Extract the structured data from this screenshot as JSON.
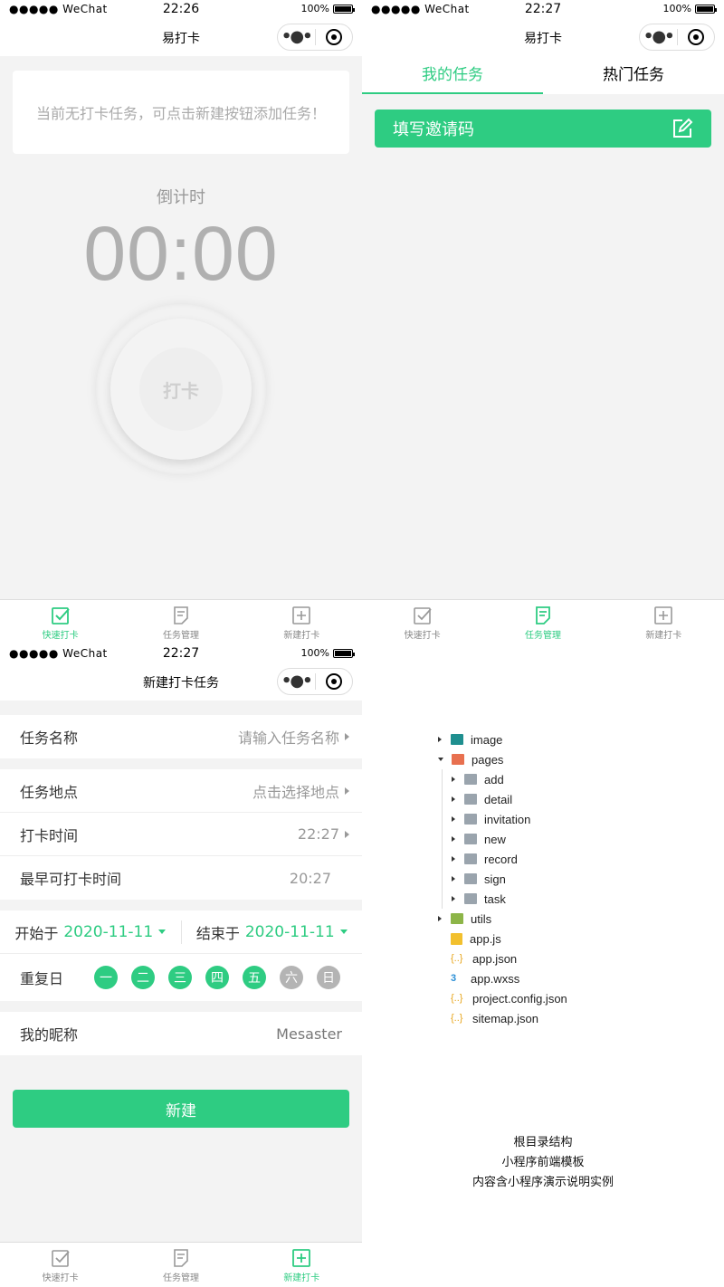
{
  "status_bars": [
    {
      "signal": "●●●●● WeChat",
      "time": "22:26",
      "battery": "100%"
    },
    {
      "signal": "●●●●● WeChat",
      "time": "22:27",
      "battery": "100%"
    },
    {
      "signal": "●●●●● WeChat",
      "time": "22:27",
      "battery": "100%"
    }
  ],
  "screen1": {
    "title": "易打卡",
    "notice": "当前无打卡任务，可点击新建按钮添加任务！",
    "countdown_label": "倒计时",
    "countdown_time": "00:00",
    "punch_label": "打卡"
  },
  "screen2": {
    "title": "易打卡",
    "tabs": [
      "我的任务",
      "热门任务"
    ],
    "invite_label": "填写邀请码"
  },
  "screen3": {
    "title": "新建打卡任务",
    "task_name_label": "任务名称",
    "task_name_placeholder": "请输入任务名称",
    "location_label": "任务地点",
    "location_placeholder": "点击选择地点",
    "punch_time_label": "打卡时间",
    "punch_time_value": "22:27",
    "earliest_label": "最早可打卡时间",
    "earliest_value": "20:27",
    "start_label": "开始于",
    "start_date": "2020-11-11",
    "end_label": "结束于",
    "end_date": "2020-11-11",
    "repeat_label": "重复日",
    "days": [
      {
        "label": "一",
        "on": true
      },
      {
        "label": "二",
        "on": true
      },
      {
        "label": "三",
        "on": true
      },
      {
        "label": "四",
        "on": true
      },
      {
        "label": "五",
        "on": true
      },
      {
        "label": "六",
        "on": false
      },
      {
        "label": "日",
        "on": false
      }
    ],
    "nickname_label": "我的昵称",
    "nickname_value": "Mesaster",
    "create_button": "新建"
  },
  "tabbar": {
    "items": [
      "快速打卡",
      "任务管理",
      "新建打卡"
    ]
  },
  "tabbar_active": {
    "screen1": 0,
    "screen2": 1,
    "screen3": 2
  },
  "file_tree": {
    "image": "image",
    "pages": "pages",
    "pages_children": [
      "add",
      "detail",
      "invitation",
      "new",
      "record",
      "sign",
      "task"
    ],
    "utils": "utils",
    "files": [
      {
        "name": "app.js",
        "icon": "js-file-icon"
      },
      {
        "name": "app.json",
        "icon": "json-file-icon"
      },
      {
        "name": "app.wxss",
        "icon": "css-file-icon"
      },
      {
        "name": "project.config.json",
        "icon": "json-file-icon"
      },
      {
        "name": "sitemap.json",
        "icon": "json-file-icon"
      }
    ]
  },
  "caption": [
    "根目录结构",
    "小程序前端模板",
    "内容含小程序演示说明实例"
  ],
  "colors": {
    "accent": "#2ecc82",
    "bg": "#f3f3f3",
    "inactive_day": "#b4b4b4"
  }
}
